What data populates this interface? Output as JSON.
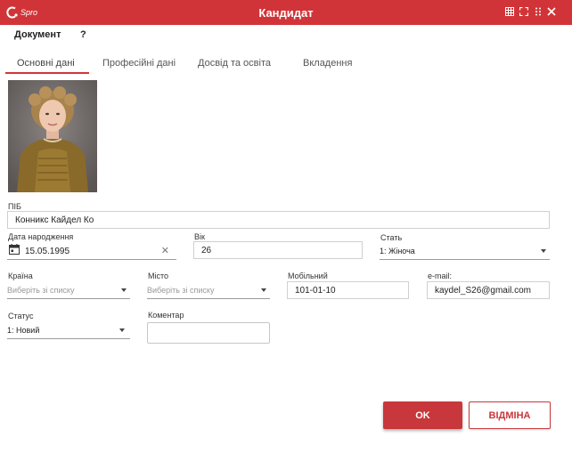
{
  "window": {
    "logo_text": "Spro",
    "title": "Кандидат"
  },
  "menu": {
    "document": "Документ",
    "help": "?"
  },
  "tabs": [
    "Основні дані",
    "Професійні дані",
    "Досвід та освіта",
    "Вкладення"
  ],
  "form": {
    "full_name": {
      "label": "ПІБ",
      "value": "Конникс Кайдел Ко"
    },
    "birth_date": {
      "label": "Дата народження",
      "value": "15.05.1995"
    },
    "age": {
      "label": "Вік",
      "value": "26"
    },
    "gender": {
      "label": "Стать",
      "value": "1: Жіноча"
    },
    "country": {
      "label": "Країна",
      "placeholder": "Виберіть зі списку"
    },
    "city": {
      "label": "Місто",
      "placeholder": "Виберіть зі списку"
    },
    "mobile": {
      "label": "Мобільний",
      "value": "101-01-10"
    },
    "email": {
      "label": "e-mail:",
      "value": "kaydel_S26@gmail.com"
    },
    "status": {
      "label": "Статус",
      "value": "1: Новий"
    },
    "comment": {
      "label": "Коментар",
      "value": ""
    }
  },
  "buttons": {
    "ok": "OK",
    "cancel": "ВІДМІНА"
  },
  "colors": {
    "accent": "#d13438",
    "button_primary": "#c8373b"
  },
  "icons": {
    "logo": "cs-pro-logo-icon",
    "grid": "grid-icon",
    "expand": "expand-icon",
    "more": "more-dots-icon",
    "close": "close-icon",
    "calendar": "calendar-icon",
    "clear": "clear-icon"
  }
}
